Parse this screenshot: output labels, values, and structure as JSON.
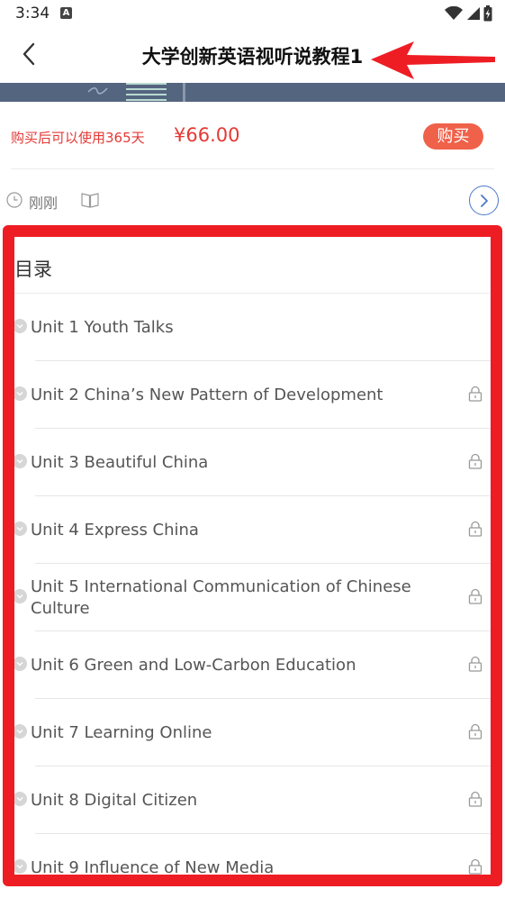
{
  "status_bar": {
    "time": "3:34",
    "notification_letter": "A",
    "icons": [
      "wifi-icon",
      "signal-icon",
      "battery-charging-icon"
    ]
  },
  "header": {
    "title": "大学创新英语视听说教程1",
    "back_icon": "chevron-left-icon"
  },
  "purchase": {
    "note": "购买后可以使用365天",
    "price": "¥66.00",
    "buy_label": "购买"
  },
  "meta": {
    "updated": "刚刚",
    "icons": [
      "clock-icon",
      "book-icon",
      "chevron-right-circle-icon"
    ]
  },
  "toc": {
    "title": "目录",
    "items": [
      {
        "label": "Unit 1 Youth Talks",
        "locked": false
      },
      {
        "label": "Unit 2 China’s New Pattern of Development",
        "locked": true
      },
      {
        "label": "Unit 3 Beautiful China",
        "locked": true
      },
      {
        "label": "Unit 4 Express China",
        "locked": true
      },
      {
        "label": "Unit 5 International Communication of Chinese Culture",
        "locked": true
      },
      {
        "label": "Unit 6 Green and Low-Carbon Education",
        "locked": true
      },
      {
        "label": "Unit 7 Learning Online",
        "locked": true
      },
      {
        "label": "Unit 8 Digital Citizen",
        "locked": true
      },
      {
        "label": "Unit 9 Influence of New Media",
        "locked": true
      }
    ]
  },
  "colors": {
    "accent_red": "#e53935",
    "buy_button": "#f0614a",
    "highlight_border": "#ee1d24",
    "link_blue": "#4a78c8",
    "banner": "#54657f"
  }
}
